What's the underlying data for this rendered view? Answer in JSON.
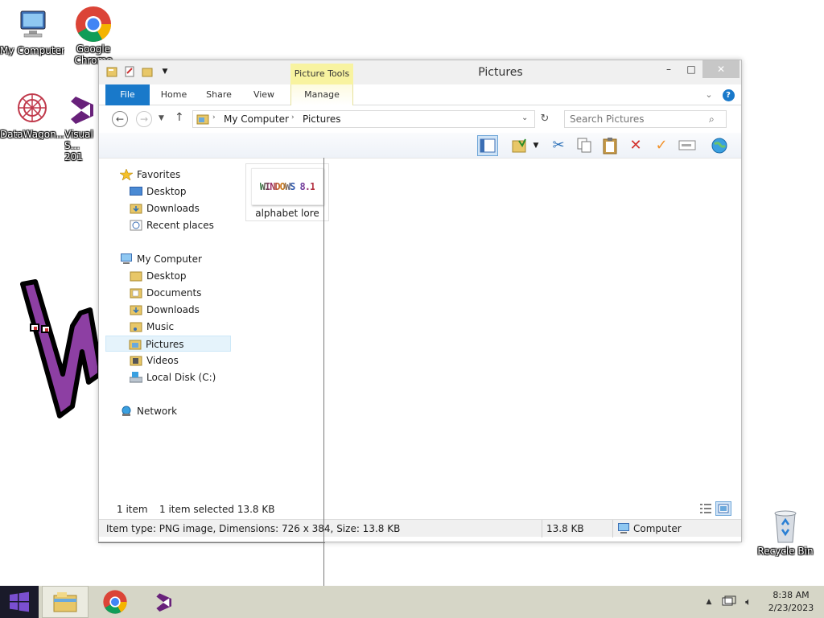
{
  "desktop": {
    "icons": [
      {
        "label": "My Computer",
        "icon": "computer-icon"
      },
      {
        "label": "Google Chrome",
        "icon": "chrome-icon"
      },
      {
        "label": "DataWagon...",
        "icon": "datawagon-icon"
      },
      {
        "label": "Visual S... 201",
        "icon": "visual-studio-icon"
      },
      {
        "label": "Recycle Bin",
        "icon": "recycle-bin-icon"
      }
    ]
  },
  "window": {
    "title": "Pictures",
    "context_tab_header": "Picture Tools",
    "controls": {
      "minimize": "–",
      "maximize": "□",
      "close": "✕"
    },
    "ribbon_tabs": [
      "File",
      "Home",
      "Share",
      "View",
      "Manage"
    ],
    "help": "?",
    "address": {
      "segments": [
        "My Computer",
        "Pictures"
      ]
    },
    "search_placeholder": "Search Pictures",
    "navigation": {
      "favorites_label": "Favorites",
      "favorites": [
        "Desktop",
        "Downloads",
        "Recent places"
      ],
      "computer_label": "My Computer",
      "computer": [
        "Desktop",
        "Documents",
        "Downloads",
        "Music",
        "Pictures",
        "Videos",
        "Local Disk (C:)"
      ],
      "network_label": "Network"
    },
    "files": [
      {
        "name": "alphabet lore",
        "thumb_text": "WINDOWS 8.1"
      }
    ],
    "status": {
      "count": "1 item",
      "selection": "1 item selected  13.8 KB"
    },
    "details": {
      "info": "Item type: PNG image, Dimensions: 726 x 384, Size: 13.8 KB",
      "size": "13.8 KB",
      "location": "Computer"
    }
  },
  "taskbar": {
    "time": "8:38 AM",
    "date": "2/23/2023"
  },
  "colors": {
    "file_tab": "#1979ca",
    "context_tab": "#f8f3a0",
    "taskbar": "#d6d6c7",
    "selection": "#e5f3fb"
  }
}
